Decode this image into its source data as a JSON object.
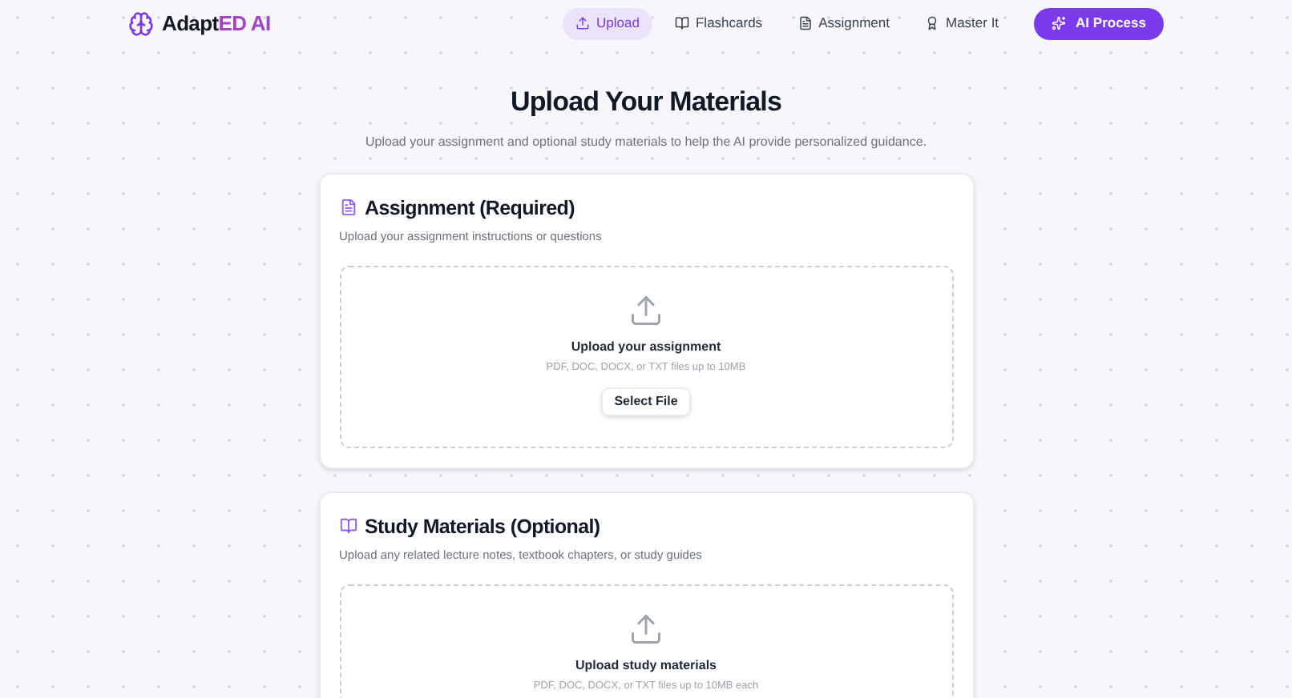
{
  "brand": {
    "name": "Adapt",
    "accent": "ED AI"
  },
  "nav": [
    {
      "label": "Upload",
      "selected": true
    },
    {
      "label": "Flashcards",
      "selected": false
    },
    {
      "label": "Assignment",
      "selected": false
    },
    {
      "label": "Master It",
      "selected": false
    }
  ],
  "action_button": {
    "label": "AI Process"
  },
  "page": {
    "title": "Upload Your Materials",
    "subtitle": "Upload your assignment and optional study materials to help the AI provide personalized guidance."
  },
  "sections": [
    {
      "title": "Assignment (Required)",
      "description": "Upload your assignment instructions or questions",
      "drop_title": "Upload your assignment",
      "drop_hint": "PDF, DOC, DOCX, or TXT files up to 10MB",
      "button": "Select File"
    },
    {
      "title": "Study Materials (Optional)",
      "description": "Upload any related lecture notes, textbook chapters, or study guides",
      "drop_title": "Upload study materials",
      "drop_hint": "PDF, DOC, DOCX, or TXT files up to 10MB each"
    }
  ]
}
